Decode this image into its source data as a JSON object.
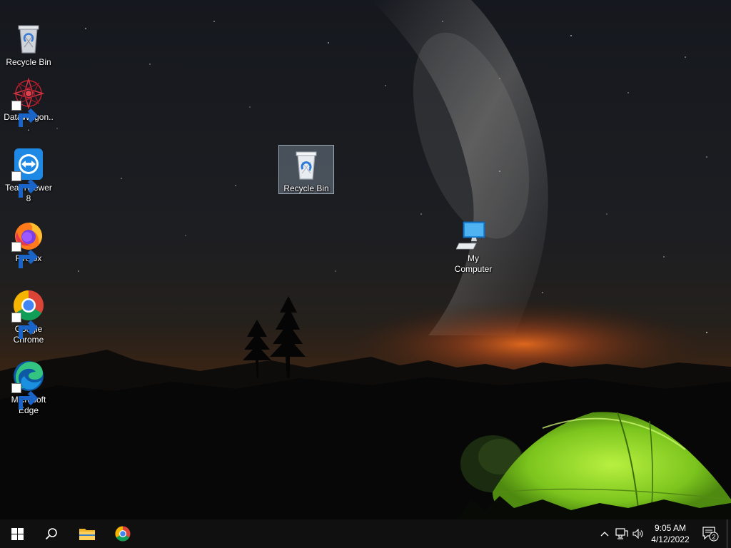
{
  "desktop": {
    "icons": [
      {
        "label": "Recycle Bin",
        "icon": "recycle-bin-icon"
      },
      {
        "label": "DataWagon...",
        "icon": "datawagon-icon"
      },
      {
        "label": "TeamViewer 8",
        "icon": "teamviewer-icon"
      },
      {
        "label": "Firefox",
        "icon": "firefox-icon"
      },
      {
        "label": "Google Chrome",
        "icon": "chrome-icon"
      },
      {
        "label": "Microsoft Edge",
        "icon": "edge-icon"
      },
      {
        "label": "Recycle Bin",
        "icon": "recycle-bin-icon"
      },
      {
        "label": "My Computer",
        "icon": "computer-icon"
      }
    ]
  },
  "taskbar": {
    "pinned": [
      {
        "name": "start",
        "icon": "windows-logo-icon"
      },
      {
        "name": "search",
        "icon": "search-icon"
      },
      {
        "name": "file-explorer",
        "icon": "folder-icon"
      },
      {
        "name": "google-chrome",
        "icon": "chrome-icon"
      }
    ],
    "tray": {
      "time": "9:05 AM",
      "date": "4/12/2022",
      "notification_count": "2"
    }
  },
  "colors": {
    "taskbar": "#101010",
    "tent": "#8fdc2a",
    "horizon_glow": "#e0601c",
    "selection": "#a0b4c8"
  }
}
